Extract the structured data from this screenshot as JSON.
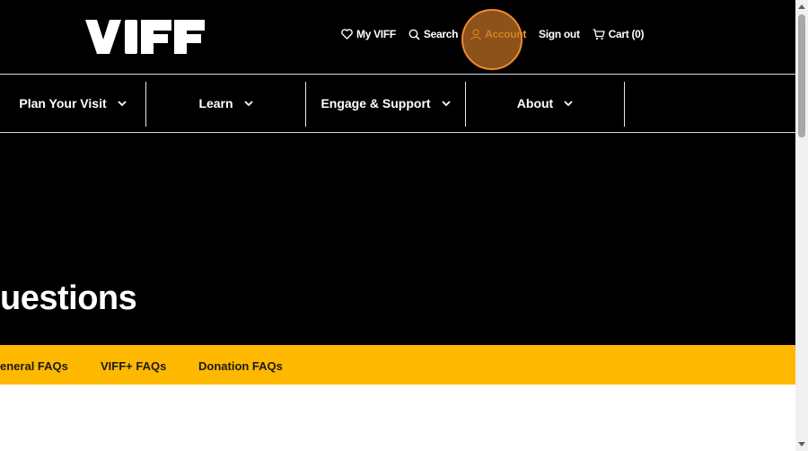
{
  "header": {
    "logo_text": "VIFF",
    "utility": {
      "my_viff": "My VIFF",
      "search": "Search",
      "account": "Account",
      "sign_out": "Sign out",
      "cart": "Cart (0)"
    }
  },
  "nav": {
    "items": [
      {
        "label": "Plan Your Visit"
      },
      {
        "label": "Learn"
      },
      {
        "label": "Engage & Support"
      },
      {
        "label": "About"
      }
    ]
  },
  "hero": {
    "title": "uestions"
  },
  "faq_tabs": [
    {
      "label": "eneral FAQs"
    },
    {
      "label": "VIFF+ FAQs"
    },
    {
      "label": "Donation FAQs"
    }
  ],
  "colors": {
    "header_bg": "#000000",
    "accent_yellow": "#ffb800",
    "highlight": "#c47024"
  },
  "icons": {
    "my_viff": "heart-icon",
    "search": "search-icon",
    "account": "user-icon",
    "cart": "cart-icon",
    "nav_chevron": "chevron-down-icon"
  }
}
